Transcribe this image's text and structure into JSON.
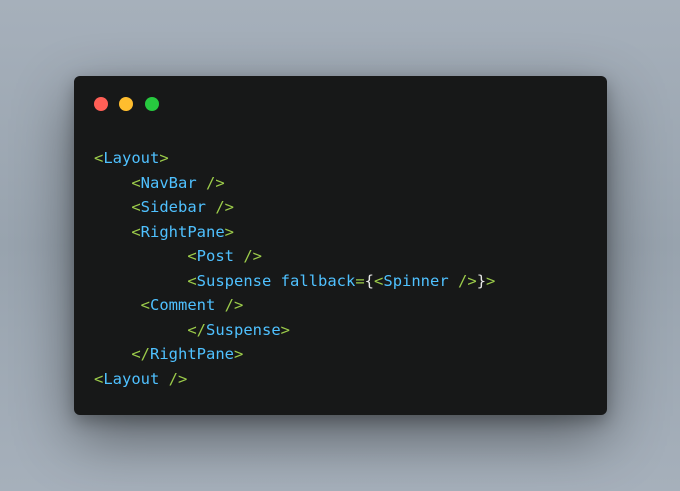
{
  "window": {
    "traffic_lights": [
      "#ff5f56",
      "#ffbd2e",
      "#27c93f"
    ]
  },
  "code": {
    "colors": {
      "angle": "#9ccc4a",
      "tag": "#4fc1ff",
      "brace": "#e8e8e8"
    },
    "lines": [
      {
        "indent": "",
        "open": "<",
        "tag": "Layout",
        "close": ">"
      },
      {
        "indent": "    ",
        "open": "<",
        "tag": "NavBar",
        "close": " />"
      },
      {
        "indent": "    ",
        "open": "<",
        "tag": "Sidebar",
        "close": " />"
      },
      {
        "indent": "    ",
        "open": "<",
        "tag": "RightPane",
        "close": ">"
      },
      {
        "indent": "          ",
        "open": "<",
        "tag": "Post",
        "close": " />"
      },
      {
        "indent": "          ",
        "open": "<",
        "tag": "Suspense",
        "attr": " fallback",
        "eq": "=",
        "brace_open": "{",
        "inner_open": "<",
        "inner_tag": "Spinner",
        "inner_close": " />",
        "brace_close": "}",
        "close": ">"
      },
      {
        "indent": "     ",
        "open": "<",
        "tag": "Comment",
        "close": " />"
      },
      {
        "indent": "          ",
        "open": "</",
        "tag": "Suspense",
        "close": ">"
      },
      {
        "indent": "    ",
        "open": "</",
        "tag": "RightPane",
        "close": ">"
      },
      {
        "indent": "",
        "open": "<",
        "tag": "Layout",
        "close": " />"
      }
    ]
  }
}
